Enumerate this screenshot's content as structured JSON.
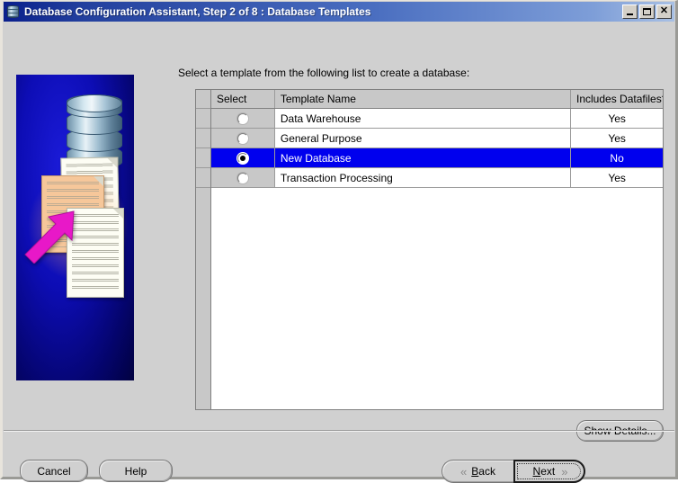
{
  "window": {
    "title": "Database Configuration Assistant, Step 2 of 8 : Database Templates",
    "icon": "database-cylinder-icon",
    "controls": {
      "minimize": "minimize-icon",
      "maximize": "maximize-icon",
      "close": "close-icon"
    }
  },
  "illustration": {
    "name": "database-templates-illustration",
    "background_color": "#0d0db5",
    "arrow_color": "#e818c8",
    "elements": [
      "database-cylinder",
      "paper-sheets",
      "magenta-arrow"
    ]
  },
  "main": {
    "instruction": "Select a template from the following list to create a database:",
    "table": {
      "columns": [
        "Select",
        "Template Name",
        "Includes Datafiles?"
      ],
      "rows": [
        {
          "selected": false,
          "name": "Data Warehouse",
          "includes_datafiles": "Yes"
        },
        {
          "selected": false,
          "name": "General Purpose",
          "includes_datafiles": "Yes"
        },
        {
          "selected": true,
          "name": "New Database",
          "includes_datafiles": "No"
        },
        {
          "selected": false,
          "name": "Transaction Processing",
          "includes_datafiles": "Yes"
        }
      ],
      "selected_row_color": "#0000ee"
    },
    "show_details_label": "Show Details..."
  },
  "footer": {
    "cancel_label": "Cancel",
    "help_label": "Help",
    "back_label": "Back",
    "back_icon": "chevron-left-double-icon",
    "next_label": "Next",
    "next_icon": "chevron-right-double-icon"
  }
}
